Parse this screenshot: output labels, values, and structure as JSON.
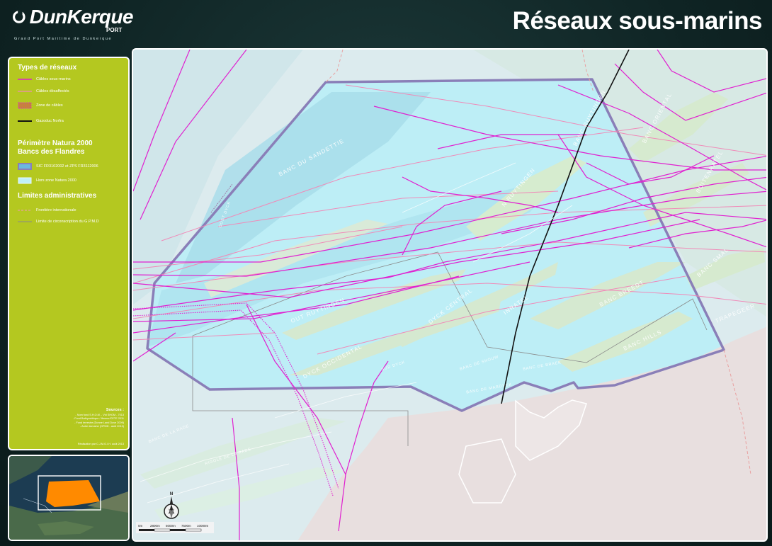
{
  "header": {
    "brand_name": "DunKerque",
    "brand_port": "PORT",
    "brand_sub": "Grand Port Maritime de Dunkerque",
    "title": "Réseaux sous-marins"
  },
  "legend": {
    "section1_title": "Types de réseaux",
    "items1": [
      {
        "label": "Câbles sous-marins",
        "color": "#e020d0"
      },
      {
        "label": "Câbles désaffectés",
        "color": "#f08ab8"
      },
      {
        "label": "Zone de câbles",
        "color": "#e020d0"
      },
      {
        "label": "Gazoduc Norfra",
        "color": "#111111"
      }
    ],
    "section2_title_line1": "Périmètre Natura 2000",
    "section2_title_line2": "Bancs des Flandres",
    "items2": [
      {
        "label": "SIC FR3102002 et ZPS FR3112006",
        "color": "#8a7fb8"
      },
      {
        "label": "Hors zone Natura 2000",
        "color": "#bff0f8"
      }
    ],
    "section3_title": "Limites administratives",
    "items3": [
      {
        "label": "Frontière internationale",
        "color": "#e8a0a0"
      },
      {
        "label": "Limite de circonscription du G.P.M.D",
        "color": "#8a8a8a"
      }
    ],
    "sources_title": "Sources :",
    "sources_lines": [
      "- Nom fond S.H.O.M. - Vct SHOM - 7013",
      "- Fond Bathymétrique / Ifremer/CETE 2011",
      "- Fond terrestre (Donne Land Dove 2009)",
      "- Autre domaine (GPMD - août 2013)"
    ],
    "credit": "Réalisation par C.J.M.G.I.H. août 2013"
  },
  "map": {
    "bank_labels": [
      "Banc du Sandettie",
      "Banc Oriental",
      "Banc Ruytingen",
      "N Ruytingen",
      "Buitenratel",
      "Banc Smal",
      "Out Ruytingen",
      "Dyck Central",
      "Inratel",
      "Banc Breedt",
      "Dyck Occidental",
      "Banc Hills",
      "Trapegeer",
      "Banc de Snouw",
      "Banc de Braek",
      "Banc de Mardyck",
      "Sud Dyck",
      "Rigole de la Rade",
      "Banc de la Rade",
      "Oost Dyck"
    ],
    "scale_labels": [
      "0m",
      "2800m",
      "5000m",
      "7500m",
      "10000m"
    ],
    "north_label": "N"
  },
  "colors": {
    "legend_bg": "#b4c820",
    "cable": "#e020d0",
    "cable_disused": "#f08ab8",
    "natura": "#8a7fb8",
    "pipeline": "#111111",
    "land": "#e8dfdf"
  }
}
